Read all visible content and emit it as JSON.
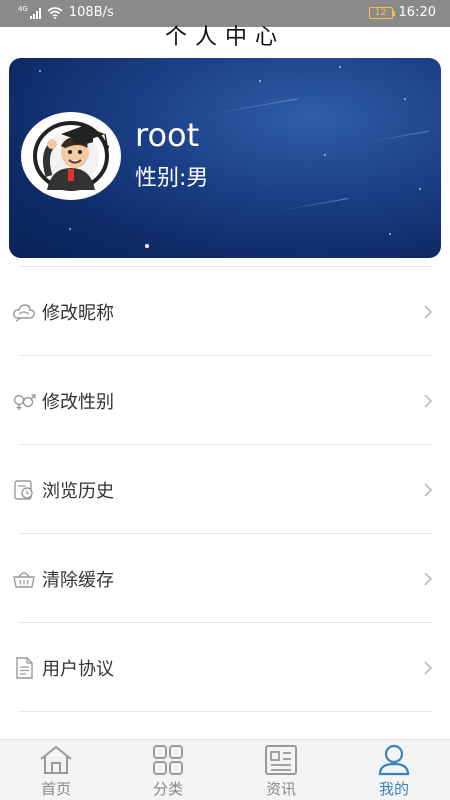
{
  "status_bar": {
    "network_type": "4G",
    "speed": "108B/s",
    "battery": "12",
    "time": "16:20"
  },
  "header": {
    "title": "个人中心"
  },
  "profile": {
    "username": "root",
    "gender_line": "性别:男",
    "avatar_icon": "cartoon-graduate-avatar"
  },
  "menu": {
    "items": [
      {
        "label": "修改昵称",
        "icon": "cloud-icon"
      },
      {
        "label": "修改性别",
        "icon": "gender-icon"
      },
      {
        "label": "浏览历史",
        "icon": "history-icon"
      },
      {
        "label": "清除缓存",
        "icon": "basket-icon"
      },
      {
        "label": "用户协议",
        "icon": "document-icon"
      }
    ]
  },
  "bottom_nav": {
    "items": [
      {
        "label": "首页",
        "icon": "home-icon"
      },
      {
        "label": "分类",
        "icon": "grid-icon"
      },
      {
        "label": "资讯",
        "icon": "news-icon"
      },
      {
        "label": "我的",
        "icon": "user-icon",
        "active": true
      }
    ],
    "active_color": "#3b82c4",
    "inactive_color": "#888888"
  }
}
